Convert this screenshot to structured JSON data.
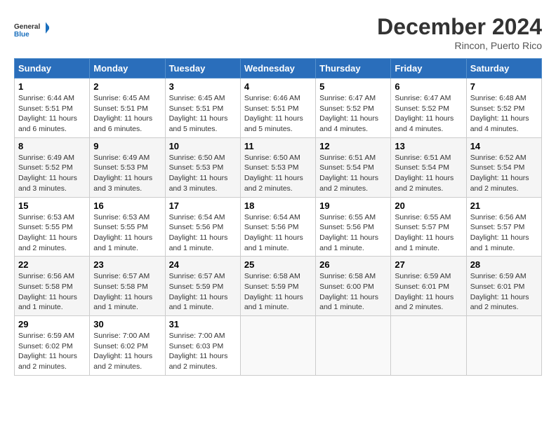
{
  "logo": {
    "line1": "General",
    "line2": "Blue"
  },
  "title": "December 2024",
  "location": "Rincon, Puerto Rico",
  "days_of_week": [
    "Sunday",
    "Monday",
    "Tuesday",
    "Wednesday",
    "Thursday",
    "Friday",
    "Saturday"
  ],
  "weeks": [
    [
      {
        "day": 1,
        "info": "Sunrise: 6:44 AM\nSunset: 5:51 PM\nDaylight: 11 hours\nand 6 minutes."
      },
      {
        "day": 2,
        "info": "Sunrise: 6:45 AM\nSunset: 5:51 PM\nDaylight: 11 hours\nand 6 minutes."
      },
      {
        "day": 3,
        "info": "Sunrise: 6:45 AM\nSunset: 5:51 PM\nDaylight: 11 hours\nand 5 minutes."
      },
      {
        "day": 4,
        "info": "Sunrise: 6:46 AM\nSunset: 5:51 PM\nDaylight: 11 hours\nand 5 minutes."
      },
      {
        "day": 5,
        "info": "Sunrise: 6:47 AM\nSunset: 5:52 PM\nDaylight: 11 hours\nand 4 minutes."
      },
      {
        "day": 6,
        "info": "Sunrise: 6:47 AM\nSunset: 5:52 PM\nDaylight: 11 hours\nand 4 minutes."
      },
      {
        "day": 7,
        "info": "Sunrise: 6:48 AM\nSunset: 5:52 PM\nDaylight: 11 hours\nand 4 minutes."
      }
    ],
    [
      {
        "day": 8,
        "info": "Sunrise: 6:49 AM\nSunset: 5:52 PM\nDaylight: 11 hours\nand 3 minutes."
      },
      {
        "day": 9,
        "info": "Sunrise: 6:49 AM\nSunset: 5:53 PM\nDaylight: 11 hours\nand 3 minutes."
      },
      {
        "day": 10,
        "info": "Sunrise: 6:50 AM\nSunset: 5:53 PM\nDaylight: 11 hours\nand 3 minutes."
      },
      {
        "day": 11,
        "info": "Sunrise: 6:50 AM\nSunset: 5:53 PM\nDaylight: 11 hours\nand 2 minutes."
      },
      {
        "day": 12,
        "info": "Sunrise: 6:51 AM\nSunset: 5:54 PM\nDaylight: 11 hours\nand 2 minutes."
      },
      {
        "day": 13,
        "info": "Sunrise: 6:51 AM\nSunset: 5:54 PM\nDaylight: 11 hours\nand 2 minutes."
      },
      {
        "day": 14,
        "info": "Sunrise: 6:52 AM\nSunset: 5:54 PM\nDaylight: 11 hours\nand 2 minutes."
      }
    ],
    [
      {
        "day": 15,
        "info": "Sunrise: 6:53 AM\nSunset: 5:55 PM\nDaylight: 11 hours\nand 2 minutes."
      },
      {
        "day": 16,
        "info": "Sunrise: 6:53 AM\nSunset: 5:55 PM\nDaylight: 11 hours\nand 1 minute."
      },
      {
        "day": 17,
        "info": "Sunrise: 6:54 AM\nSunset: 5:56 PM\nDaylight: 11 hours\nand 1 minute."
      },
      {
        "day": 18,
        "info": "Sunrise: 6:54 AM\nSunset: 5:56 PM\nDaylight: 11 hours\nand 1 minute."
      },
      {
        "day": 19,
        "info": "Sunrise: 6:55 AM\nSunset: 5:56 PM\nDaylight: 11 hours\nand 1 minute."
      },
      {
        "day": 20,
        "info": "Sunrise: 6:55 AM\nSunset: 5:57 PM\nDaylight: 11 hours\nand 1 minute."
      },
      {
        "day": 21,
        "info": "Sunrise: 6:56 AM\nSunset: 5:57 PM\nDaylight: 11 hours\nand 1 minute."
      }
    ],
    [
      {
        "day": 22,
        "info": "Sunrise: 6:56 AM\nSunset: 5:58 PM\nDaylight: 11 hours\nand 1 minute."
      },
      {
        "day": 23,
        "info": "Sunrise: 6:57 AM\nSunset: 5:58 PM\nDaylight: 11 hours\nand 1 minute."
      },
      {
        "day": 24,
        "info": "Sunrise: 6:57 AM\nSunset: 5:59 PM\nDaylight: 11 hours\nand 1 minute."
      },
      {
        "day": 25,
        "info": "Sunrise: 6:58 AM\nSunset: 5:59 PM\nDaylight: 11 hours\nand 1 minute."
      },
      {
        "day": 26,
        "info": "Sunrise: 6:58 AM\nSunset: 6:00 PM\nDaylight: 11 hours\nand 1 minute."
      },
      {
        "day": 27,
        "info": "Sunrise: 6:59 AM\nSunset: 6:01 PM\nDaylight: 11 hours\nand 2 minutes."
      },
      {
        "day": 28,
        "info": "Sunrise: 6:59 AM\nSunset: 6:01 PM\nDaylight: 11 hours\nand 2 minutes."
      }
    ],
    [
      {
        "day": 29,
        "info": "Sunrise: 6:59 AM\nSunset: 6:02 PM\nDaylight: 11 hours\nand 2 minutes."
      },
      {
        "day": 30,
        "info": "Sunrise: 7:00 AM\nSunset: 6:02 PM\nDaylight: 11 hours\nand 2 minutes."
      },
      {
        "day": 31,
        "info": "Sunrise: 7:00 AM\nSunset: 6:03 PM\nDaylight: 11 hours\nand 2 minutes."
      },
      null,
      null,
      null,
      null
    ]
  ]
}
